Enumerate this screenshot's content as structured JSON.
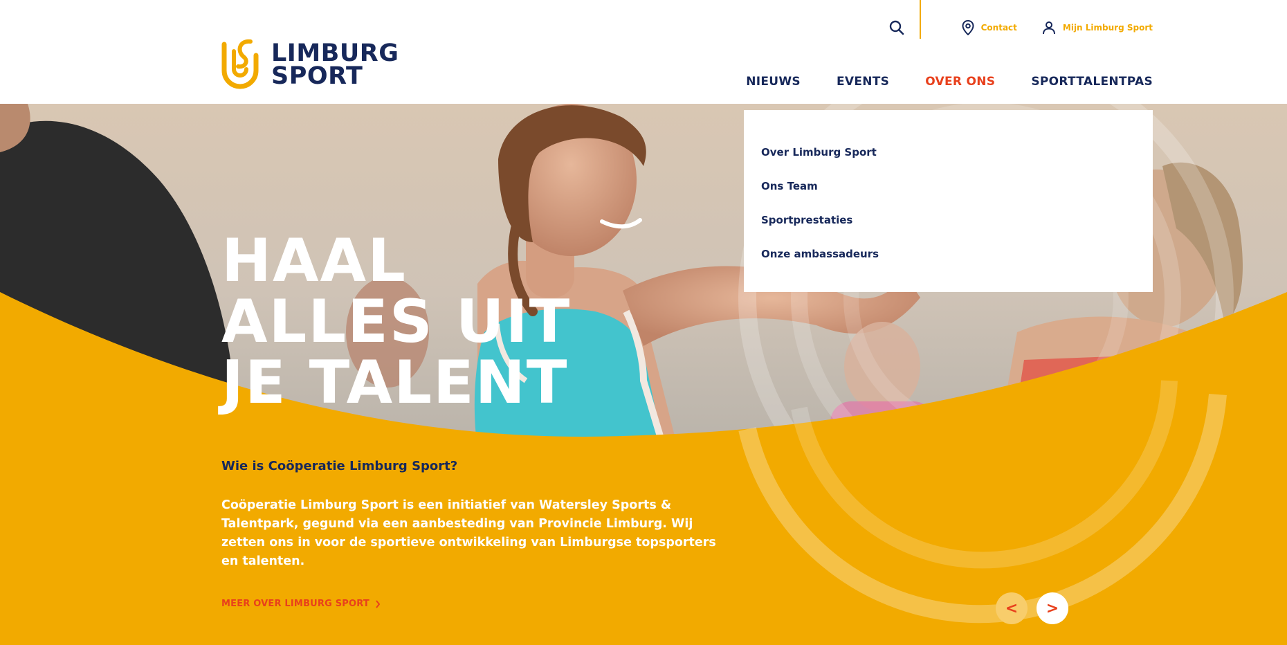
{
  "brand": {
    "line1": "LIMBURG",
    "line2": "SPORT",
    "logo_icon": "ls-monogram-icon"
  },
  "colors": {
    "accent": "#f2aa00",
    "navy": "#17285a",
    "active": "#e8401c",
    "white": "#ffffff"
  },
  "utility": {
    "search_icon": "search-icon",
    "contact_label": "Contact",
    "account_label": "Mijn Limburg Sport"
  },
  "nav": {
    "items": [
      {
        "label": "NIEUWS"
      },
      {
        "label": "EVENTS"
      },
      {
        "label": "OVER ONS"
      },
      {
        "label": "SPORTTALENTPAS"
      }
    ]
  },
  "dropdown": {
    "items": [
      {
        "label": "Over Limburg Sport"
      },
      {
        "label": "Ons Team"
      },
      {
        "label": "Sportprestaties"
      },
      {
        "label": "Onze ambassadeurs"
      }
    ]
  },
  "hero": {
    "headline": {
      "line1": "HAAL",
      "line2": "ALLES UIT",
      "line3": "JE TALENT"
    },
    "intro_heading": "Wie is Coöperatie Limburg Sport?",
    "intro_body": "Coöperatie Limburg Sport is een initiatief van Watersley Sports & Talentpark, gegund via een aanbesteding van Provincie Limburg. Wij zetten ons in voor de sportieve ontwikkeling van Limburgse topsporters en talenten.",
    "more_link": "MEER OVER LIMBURG SPORT",
    "prev_label": "<",
    "next_label": ">"
  }
}
